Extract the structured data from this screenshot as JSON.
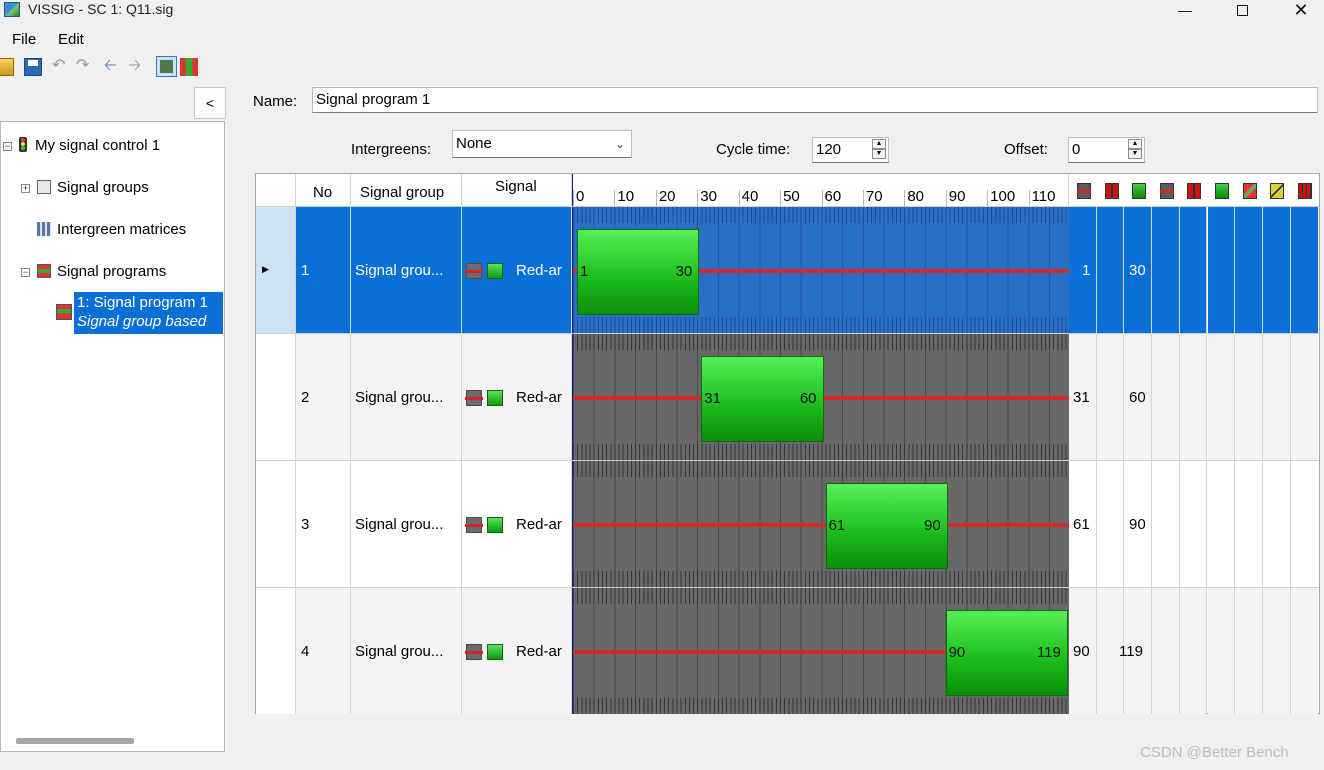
{
  "window": {
    "title": "VISSIG - SC 1: Q11.sig",
    "min_icon": "minimize-icon",
    "max_icon": "maximize-icon",
    "close_icon": "close-icon"
  },
  "menu": {
    "file": "File",
    "edit": "Edit"
  },
  "tree": {
    "root": "My signal control 1",
    "groups": "Signal groups",
    "intergreen": "Intergreen matrices",
    "programs": "Signal programs",
    "program_item_line1": "1: Signal program 1",
    "program_item_line2": "Signal group based",
    "collapse_label": "<"
  },
  "form": {
    "name_label": "Name:",
    "name_value": "Signal program 1",
    "intergreens_label": "Intergreens:",
    "intergreens_value": "None",
    "cycle_label": "Cycle time:",
    "cycle_value": "120",
    "offset_label": "Offset:",
    "offset_value": "0"
  },
  "table": {
    "headers": {
      "no": "No",
      "group": "Signal group",
      "signal": "Signal"
    },
    "ticks": [
      "0",
      "10",
      "20",
      "30",
      "40",
      "50",
      "60",
      "70",
      "80",
      "90",
      "100",
      "110"
    ],
    "rows": [
      {
        "no": "1",
        "group": "Signal grou...",
        "signal": "Red-ar",
        "start": "1",
        "end": "30",
        "start_value": 1,
        "end_value": 30,
        "selected": true
      },
      {
        "no": "2",
        "group": "Signal grou...",
        "signal": "Red-ar",
        "start": "31",
        "end": "60",
        "start_value": 31,
        "end_value": 60,
        "selected": false
      },
      {
        "no": "3",
        "group": "Signal grou...",
        "signal": "Red-ar",
        "start": "61",
        "end": "90",
        "start_value": 61,
        "end_value": 90,
        "selected": false
      },
      {
        "no": "4",
        "group": "Signal grou...",
        "signal": "Red-ar",
        "start": "90",
        "end": "119",
        "start_value": 90,
        "end_value": 119,
        "selected": false
      }
    ]
  },
  "watermark": "CSDN @Better Bench",
  "colors": {
    "selection": "#0a6fd6",
    "green_start": "#58f058",
    "green_end": "#0a8f0a",
    "red_line": "#d02a2a"
  }
}
